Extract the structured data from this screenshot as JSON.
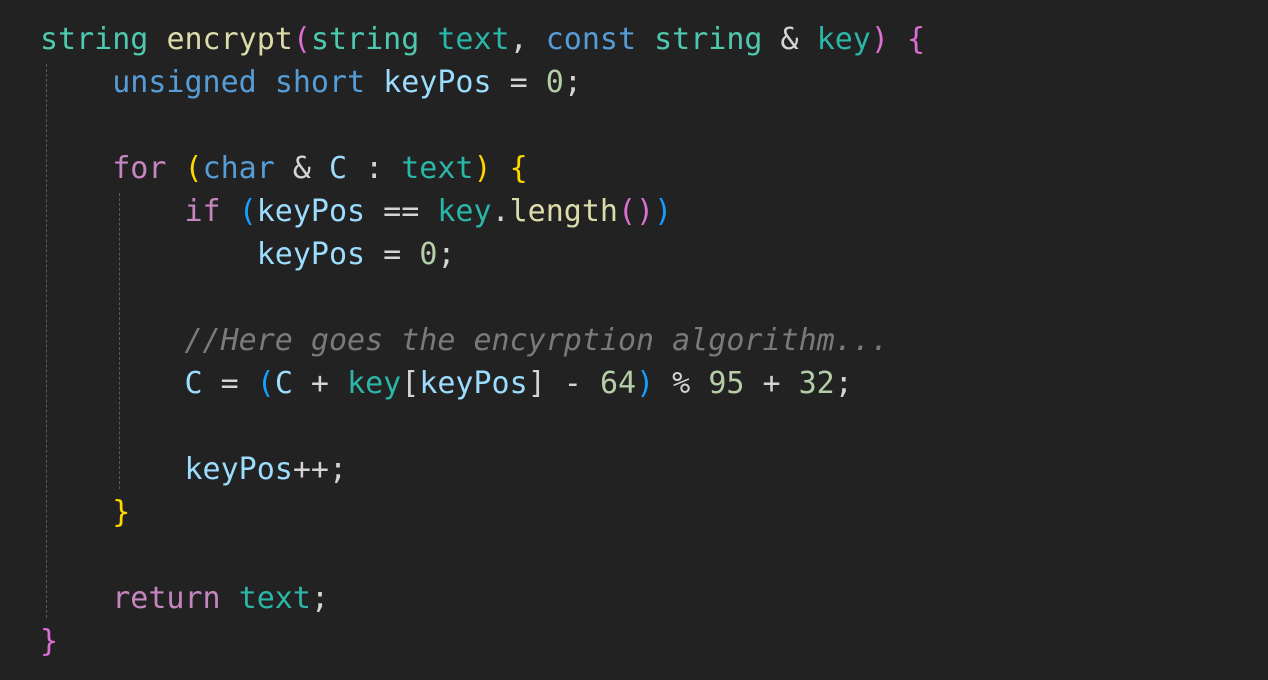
{
  "editor": {
    "theme_colors": {
      "background": "#222222",
      "type": "#4ec9b0",
      "function": "#dcdcaa",
      "keyword": "#569cd6",
      "control": "#c586c0",
      "variable": "#9cdcfe",
      "number": "#b5cea8",
      "comment": "#7a7a7a"
    },
    "lines": [
      [
        {
          "t": "string",
          "c": "tk-type"
        },
        {
          "t": " ",
          "c": "tk-op"
        },
        {
          "t": "encrypt",
          "c": "tk-fn"
        },
        {
          "t": "(",
          "c": "tk-brace1"
        },
        {
          "t": "string",
          "c": "tk-type"
        },
        {
          "t": " ",
          "c": "tk-op"
        },
        {
          "t": "text",
          "c": "tk-param"
        },
        {
          "t": ", ",
          "c": "tk-op"
        },
        {
          "t": "const",
          "c": "tk-kw"
        },
        {
          "t": " ",
          "c": "tk-op"
        },
        {
          "t": "string",
          "c": "tk-type"
        },
        {
          "t": " & ",
          "c": "tk-op"
        },
        {
          "t": "key",
          "c": "tk-param"
        },
        {
          "t": ")",
          "c": "tk-brace1"
        },
        {
          "t": " ",
          "c": "tk-op"
        },
        {
          "t": "{",
          "c": "tk-brace1"
        }
      ],
      [
        {
          "t": "    ",
          "c": "tk-op"
        },
        {
          "t": "unsigned",
          "c": "tk-kw"
        },
        {
          "t": " ",
          "c": "tk-op"
        },
        {
          "t": "short",
          "c": "tk-kw"
        },
        {
          "t": " ",
          "c": "tk-op"
        },
        {
          "t": "keyPos",
          "c": "tk-var"
        },
        {
          "t": " = ",
          "c": "tk-op"
        },
        {
          "t": "0",
          "c": "tk-num"
        },
        {
          "t": ";",
          "c": "tk-op"
        }
      ],
      [],
      [
        {
          "t": "    ",
          "c": "tk-op"
        },
        {
          "t": "for",
          "c": "tk-ctrl"
        },
        {
          "t": " ",
          "c": "tk-op"
        },
        {
          "t": "(",
          "c": "tk-brace2"
        },
        {
          "t": "char",
          "c": "tk-kw"
        },
        {
          "t": " & ",
          "c": "tk-op"
        },
        {
          "t": "C",
          "c": "tk-var"
        },
        {
          "t": " : ",
          "c": "tk-op"
        },
        {
          "t": "text",
          "c": "tk-param"
        },
        {
          "t": ")",
          "c": "tk-brace2"
        },
        {
          "t": " ",
          "c": "tk-op"
        },
        {
          "t": "{",
          "c": "tk-brace2"
        }
      ],
      [
        {
          "t": "        ",
          "c": "tk-op"
        },
        {
          "t": "if",
          "c": "tk-ctrl"
        },
        {
          "t": " ",
          "c": "tk-op"
        },
        {
          "t": "(",
          "c": "tk-brace3"
        },
        {
          "t": "keyPos",
          "c": "tk-var"
        },
        {
          "t": " == ",
          "c": "tk-op"
        },
        {
          "t": "key",
          "c": "tk-param"
        },
        {
          "t": ".",
          "c": "tk-op"
        },
        {
          "t": "length",
          "c": "tk-fn"
        },
        {
          "t": "()",
          "c": "tk-brace1"
        },
        {
          "t": ")",
          "c": "tk-brace3"
        }
      ],
      [
        {
          "t": "            ",
          "c": "tk-op"
        },
        {
          "t": "keyPos",
          "c": "tk-var"
        },
        {
          "t": " = ",
          "c": "tk-op"
        },
        {
          "t": "0",
          "c": "tk-num"
        },
        {
          "t": ";",
          "c": "tk-op"
        }
      ],
      [],
      [
        {
          "t": "        ",
          "c": "tk-op"
        },
        {
          "t": "//Here goes the encyrption algorithm...",
          "c": "tk-cmt"
        }
      ],
      [
        {
          "t": "        ",
          "c": "tk-op"
        },
        {
          "t": "C",
          "c": "tk-var"
        },
        {
          "t": " = ",
          "c": "tk-op"
        },
        {
          "t": "(",
          "c": "tk-brace3"
        },
        {
          "t": "C",
          "c": "tk-var"
        },
        {
          "t": " + ",
          "c": "tk-op"
        },
        {
          "t": "key",
          "c": "tk-param"
        },
        {
          "t": "[",
          "c": "tk-op"
        },
        {
          "t": "keyPos",
          "c": "tk-var"
        },
        {
          "t": "] - ",
          "c": "tk-op"
        },
        {
          "t": "64",
          "c": "tk-num"
        },
        {
          "t": ")",
          "c": "tk-brace3"
        },
        {
          "t": " % ",
          "c": "tk-op"
        },
        {
          "t": "95",
          "c": "tk-num"
        },
        {
          "t": " + ",
          "c": "tk-op"
        },
        {
          "t": "32",
          "c": "tk-num"
        },
        {
          "t": ";",
          "c": "tk-op"
        }
      ],
      [],
      [
        {
          "t": "        ",
          "c": "tk-op"
        },
        {
          "t": "keyPos",
          "c": "tk-var"
        },
        {
          "t": "++;",
          "c": "tk-op"
        }
      ],
      [
        {
          "t": "    ",
          "c": "tk-op"
        },
        {
          "t": "}",
          "c": "tk-brace2"
        }
      ],
      [],
      [
        {
          "t": "    ",
          "c": "tk-op"
        },
        {
          "t": "return",
          "c": "tk-ctrl"
        },
        {
          "t": " ",
          "c": "tk-op"
        },
        {
          "t": "text",
          "c": "tk-param"
        },
        {
          "t": ";",
          "c": "tk-op"
        }
      ],
      [
        {
          "t": "}",
          "c": "tk-brace1"
        }
      ]
    ]
  }
}
